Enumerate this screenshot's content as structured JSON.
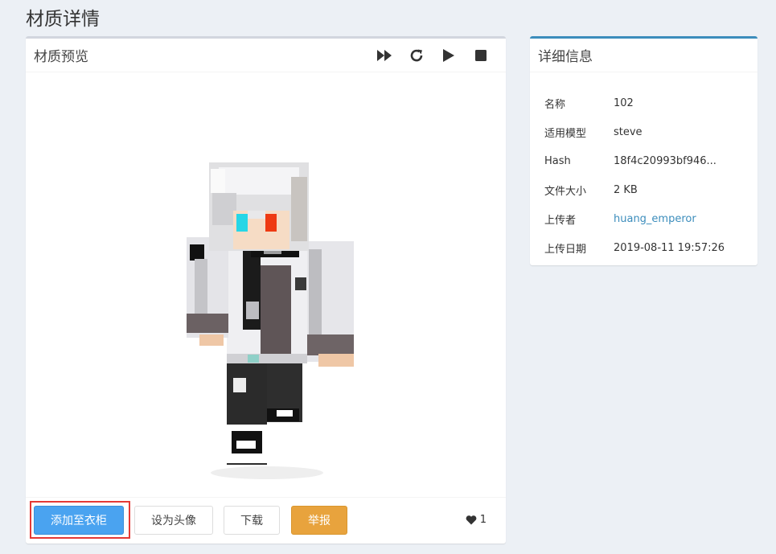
{
  "page": {
    "title": "材质详情"
  },
  "preview": {
    "title": "材质预览",
    "tools": [
      "fast-forward-icon",
      "refresh-icon",
      "play-icon",
      "stop-icon"
    ],
    "buttons": {
      "add_to_closet": "添加至衣柜",
      "set_avatar": "设为头像",
      "download": "下载",
      "report": "举报"
    },
    "likes": "1"
  },
  "info": {
    "title": "详细信息",
    "rows": [
      {
        "label": "名称",
        "value": "102"
      },
      {
        "label": "适用模型",
        "value": "steve"
      },
      {
        "label": "Hash",
        "value": "18f4c20993bf946..."
      },
      {
        "label": "文件大小",
        "value": "2 KB"
      },
      {
        "label": "上传者",
        "value": "huang_emperor"
      },
      {
        "label": "上传日期",
        "value": "2019-08-11 19:57:26"
      }
    ]
  },
  "colors": {
    "accent": "#3c8dbc",
    "primary_button": "#4aa3f0",
    "warning_button": "#e8a33d",
    "highlight": "#e53935"
  }
}
